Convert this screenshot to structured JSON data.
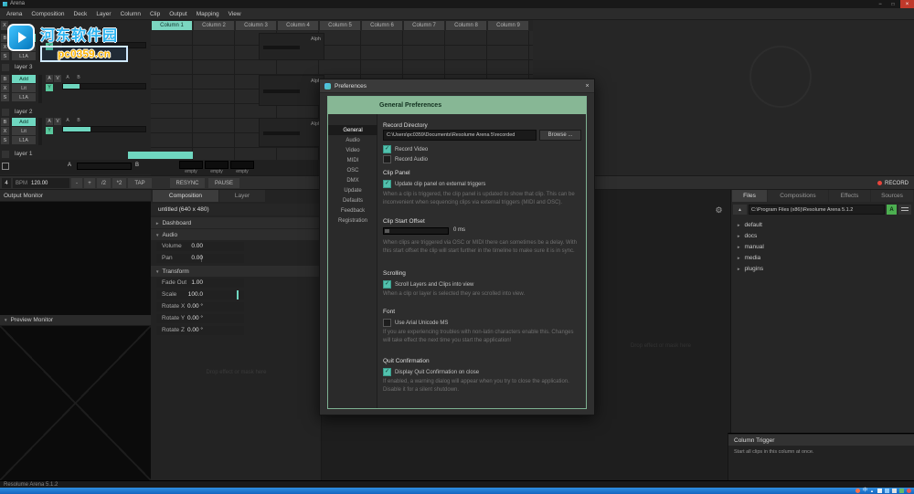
{
  "colors": {
    "accent_teal": "#6fd7c0",
    "column_active": "#7bd6c0",
    "prefs_header_green": "#87b795",
    "record_red": "#e8453c",
    "taskbar_blue": "#1f7ad4",
    "watermark_blue": "#2bb3f0",
    "watermark_yellow": "#ffb300"
  },
  "window": {
    "title": "Arena"
  },
  "menu": {
    "items": [
      "Arena",
      "Composition",
      "Deck",
      "Layer",
      "Column",
      "Clip",
      "Output",
      "Mapping",
      "View"
    ]
  },
  "watermark": {
    "site_name": "河东软件园",
    "site_url": "pc0359.cn"
  },
  "grid": {
    "x_button": "X",
    "columns": [
      "Column 1",
      "Column 2",
      "Column 3",
      "Column 4",
      "Column 5",
      "Column 6",
      "Column 7",
      "Column 8",
      "Column 9"
    ],
    "alpha_label": "Alph",
    "empty_clip_label": "empty"
  },
  "layers": {
    "names": [
      "layer 3",
      "layer 2",
      "layer 1"
    ],
    "strip": {
      "bypass": "B",
      "crossfade": "X",
      "solo": "S",
      "blend_mode": "Add",
      "lit": "Lit",
      "group": "L1A",
      "audio": "A",
      "video": "V",
      "autopilot": "Y",
      "col_a": "A",
      "col_b": "B"
    },
    "crossfader": {
      "a": "A",
      "b": "B"
    }
  },
  "transport": {
    "beat": "4",
    "bpm_label": "BPM",
    "bpm_value": "120.00",
    "decrease": "-",
    "increase": "+",
    "half": "/2",
    "double": "*2",
    "tap": "TAP",
    "resync": "RESYNC",
    "pause": "PAUSE",
    "record": "RECORD"
  },
  "output_monitor": {
    "title": "Output Monitor"
  },
  "preview_monitor": {
    "title": "Preview Monitor"
  },
  "composition": {
    "tabs": [
      "Composition",
      "Layer"
    ],
    "name": "untitled (640 x 480)",
    "dashboard_label": "Dashboard",
    "audio_label": "Audio",
    "transform_label": "Transform",
    "params": {
      "volume": {
        "label": "Volume",
        "value": "0.00"
      },
      "pan": {
        "label": "Pan",
        "value": "0.00"
      },
      "fade_out": {
        "label": "Fade Out",
        "value": "1.00"
      },
      "scale": {
        "label": "Scale",
        "value": "100.0"
      },
      "rotate_x": {
        "label": "Rotate X",
        "value": "0.00 °"
      },
      "rotate_y": {
        "label": "Rotate Y",
        "value": "0.00 °"
      },
      "rotate_z": {
        "label": "Rotate Z",
        "value": "0.00 °"
      }
    },
    "drop_hint": "Drop effect or mask here"
  },
  "clip_area": {
    "drop_hint": "Drop effect or mask here"
  },
  "files": {
    "tabs": [
      "Files",
      "Compositions",
      "Effects",
      "Sources"
    ],
    "path": "C:\\Program Files (x86)\\Resolume Arena 5.1.2",
    "sort_label": "A",
    "tree": [
      "default",
      "docs",
      "manual",
      "media",
      "plugins"
    ]
  },
  "column_trigger": {
    "title": "Column Trigger",
    "description": "Start all clips in this column at once."
  },
  "status_bar": {
    "text": "Resolume Arena 5.1.2"
  },
  "taskbar": {
    "ime_label": "中"
  },
  "preferences": {
    "title": "Preferences",
    "header": "General Preferences",
    "nav": [
      "General",
      "Audio",
      "Video",
      "MIDI",
      "OSC",
      "DMX",
      "Update",
      "Defaults",
      "Feedback",
      "Registration"
    ],
    "record_directory": {
      "label": "Record Directory",
      "value": "C:\\Users\\pc0359\\Documents\\Resolume Arena 5\\recorded",
      "browse": "Browse ...",
      "record_video": "Record Video",
      "record_audio": "Record Audio"
    },
    "clip_panel": {
      "label": "Clip Panel",
      "checkbox": "Update clip panel on external triggers",
      "description": "When a clip is triggered, the clip panel is updated to show that clip. This can be inconvenient when sequencing clips via external triggers (MIDI and OSC)."
    },
    "clip_start_offset": {
      "label": "Clip Start Offset",
      "value": "0 ms",
      "description": "When clips are triggered via OSC or MIDI there can sometimes be a delay. With this start offset the clip will start further in the timeline to make sure it is in sync."
    },
    "scrolling": {
      "label": "Scrolling",
      "checkbox": "Scroll Layers and Clips into view",
      "description": "When a clip or layer is selected they are scrolled into view."
    },
    "font": {
      "label": "Font",
      "checkbox": "Use Arial Unicode MS",
      "description": "If you are experiencing troubles with non-latin characters enable this. Changes will take effect the next time you start the application!"
    },
    "quit_confirmation": {
      "label": "Quit Confirmation",
      "checkbox": "Display Quit Confirmation on close",
      "description": "If enabled, a warning dialog will appear when you try to close the application. Disable it for a silent shutdown."
    }
  }
}
